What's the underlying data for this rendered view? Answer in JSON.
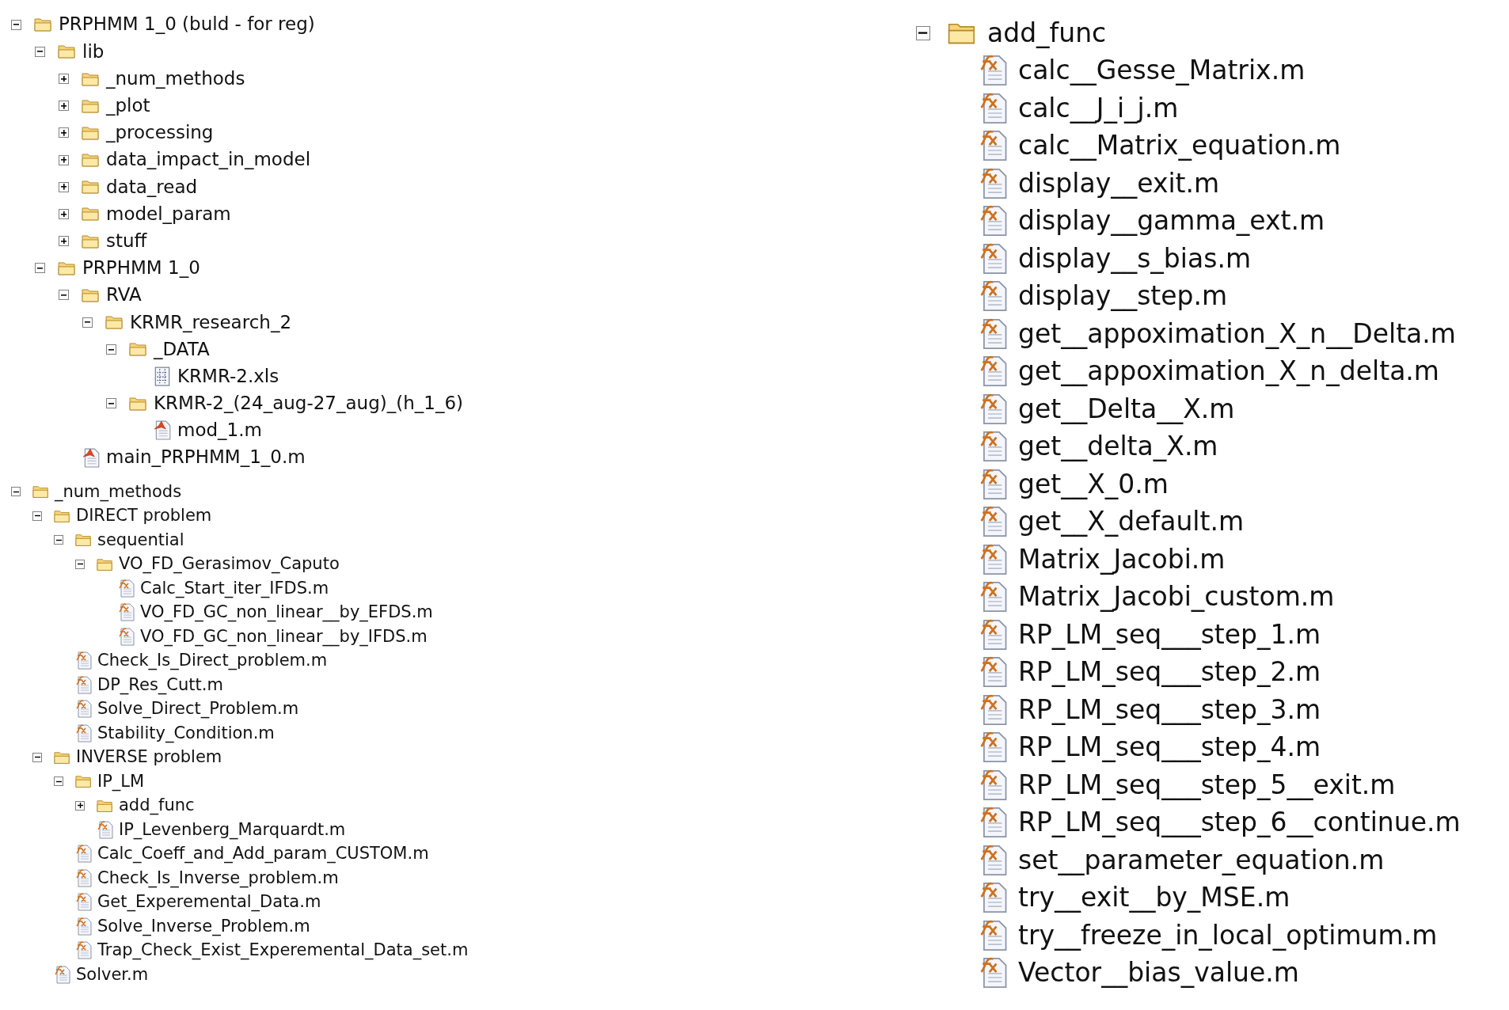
{
  "trees": [
    {
      "nodes": [
        {
          "label": "PRPHMM 1_0 (buld - for reg)",
          "kind": "folder",
          "expanded": true,
          "children": [
            {
              "label": "lib",
              "kind": "folder",
              "expanded": true,
              "children": [
                {
                  "label": "_num_methods",
                  "kind": "folder",
                  "expanded": false
                },
                {
                  "label": "_plot",
                  "kind": "folder",
                  "expanded": false
                },
                {
                  "label": "_processing",
                  "kind": "folder",
                  "expanded": false
                },
                {
                  "label": "data_impact_in_model",
                  "kind": "folder",
                  "expanded": false
                },
                {
                  "label": "data_read",
                  "kind": "folder",
                  "expanded": false
                },
                {
                  "label": "model_param",
                  "kind": "folder",
                  "expanded": false
                },
                {
                  "label": "stuff",
                  "kind": "folder",
                  "expanded": false
                }
              ]
            },
            {
              "label": "PRPHMM 1_0",
              "kind": "folder",
              "expanded": true,
              "children": [
                {
                  "label": "RVA",
                  "kind": "folder",
                  "expanded": true,
                  "children": [
                    {
                      "label": "KRMR_research_2",
                      "kind": "folder",
                      "expanded": true,
                      "children": [
                        {
                          "label": "_DATA",
                          "kind": "folder",
                          "expanded": true,
                          "children": [
                            {
                              "label": "KRMR-2.xls",
                              "kind": "spreadsheet"
                            }
                          ]
                        },
                        {
                          "label": "KRMR-2_(24_aug-27_aug)_(h_1_6)",
                          "kind": "folder",
                          "expanded": true,
                          "children": [
                            {
                              "label": "mod_1.m",
                              "kind": "script"
                            }
                          ]
                        }
                      ]
                    }
                  ]
                },
                {
                  "label": "main_PRPHMM_1_0.m",
                  "kind": "script"
                }
              ]
            }
          ]
        }
      ]
    },
    {
      "nodes": [
        {
          "label": "_num_methods",
          "kind": "folder",
          "expanded": true,
          "children": [
            {
              "label": "DIRECT problem",
              "kind": "folder",
              "expanded": true,
              "children": [
                {
                  "label": "sequential",
                  "kind": "folder",
                  "expanded": true,
                  "children": [
                    {
                      "label": "VO_FD_Gerasimov_Caputo",
                      "kind": "folder",
                      "expanded": true,
                      "children": [
                        {
                          "label": "Calc_Start_iter_IFDS.m",
                          "kind": "function"
                        },
                        {
                          "label": "VO_FD_GC_non_linear__by_EFDS.m",
                          "kind": "function"
                        },
                        {
                          "label": "VO_FD_GC_non_linear__by_IFDS.m",
                          "kind": "function"
                        }
                      ]
                    }
                  ]
                },
                {
                  "label": "Check_Is_Direct_problem.m",
                  "kind": "function"
                },
                {
                  "label": "DP_Res_Cutt.m",
                  "kind": "function"
                },
                {
                  "label": "Solve_Direct_Problem.m",
                  "kind": "function"
                },
                {
                  "label": "Stability_Condition.m",
                  "kind": "function"
                }
              ]
            },
            {
              "label": "INVERSE problem",
              "kind": "folder",
              "expanded": true,
              "children": [
                {
                  "label": "IP_LM",
                  "kind": "folder",
                  "expanded": true,
                  "children": [
                    {
                      "label": "add_func",
                      "kind": "folder",
                      "expanded": false
                    },
                    {
                      "label": "IP_Levenberg_Marquardt.m",
                      "kind": "function"
                    }
                  ]
                },
                {
                  "label": "Calc_Coeff_and_Add_param_CUSTOM.m",
                  "kind": "function"
                },
                {
                  "label": "Check_Is_Inverse_problem.m",
                  "kind": "function"
                },
                {
                  "label": "Get_Experemental_Data.m",
                  "kind": "function"
                },
                {
                  "label": "Solve_Inverse_Problem.m",
                  "kind": "function"
                },
                {
                  "label": "Trap_Check_Exist_Experemental_Data_set.m",
                  "kind": "function"
                }
              ]
            },
            {
              "label": "Solver.m",
              "kind": "function"
            }
          ]
        }
      ]
    },
    {
      "nodes": [
        {
          "label": "add_func",
          "kind": "folder",
          "expanded": true,
          "children": [
            {
              "label": "calc__Gesse_Matrix.m",
              "kind": "function"
            },
            {
              "label": "calc__J_i_j.m",
              "kind": "function"
            },
            {
              "label": "calc__Matrix_equation.m",
              "kind": "function"
            },
            {
              "label": "display__exit.m",
              "kind": "function"
            },
            {
              "label": "display__gamma_ext.m",
              "kind": "function"
            },
            {
              "label": "display__s_bias.m",
              "kind": "function"
            },
            {
              "label": "display__step.m",
              "kind": "function"
            },
            {
              "label": "get__appoximation_X_n__Delta.m",
              "kind": "function"
            },
            {
              "label": "get__appoximation_X_n_delta.m",
              "kind": "function"
            },
            {
              "label": "get__Delta__X.m",
              "kind": "function"
            },
            {
              "label": "get__delta_X.m",
              "kind": "function"
            },
            {
              "label": "get__X_0.m",
              "kind": "function"
            },
            {
              "label": "get__X_default.m",
              "kind": "function"
            },
            {
              "label": "Matrix_Jacobi.m",
              "kind": "function"
            },
            {
              "label": "Matrix_Jacobi_custom.m",
              "kind": "function"
            },
            {
              "label": "RP_LM_seq___step_1.m",
              "kind": "function"
            },
            {
              "label": "RP_LM_seq___step_2.m",
              "kind": "function"
            },
            {
              "label": "RP_LM_seq___step_3.m",
              "kind": "function"
            },
            {
              "label": "RP_LM_seq___step_4.m",
              "kind": "function"
            },
            {
              "label": "RP_LM_seq___step_5__exit.m",
              "kind": "function"
            },
            {
              "label": "RP_LM_seq___step_6__continue.m",
              "kind": "function"
            },
            {
              "label": "set__parameter_equation.m",
              "kind": "function"
            },
            {
              "label": "try__exit__by_MSE.m",
              "kind": "function"
            },
            {
              "label": "try__freeze_in_local_optimum.m",
              "kind": "function"
            },
            {
              "label": "Vector__bias_value.m",
              "kind": "function"
            }
          ]
        }
      ]
    }
  ]
}
